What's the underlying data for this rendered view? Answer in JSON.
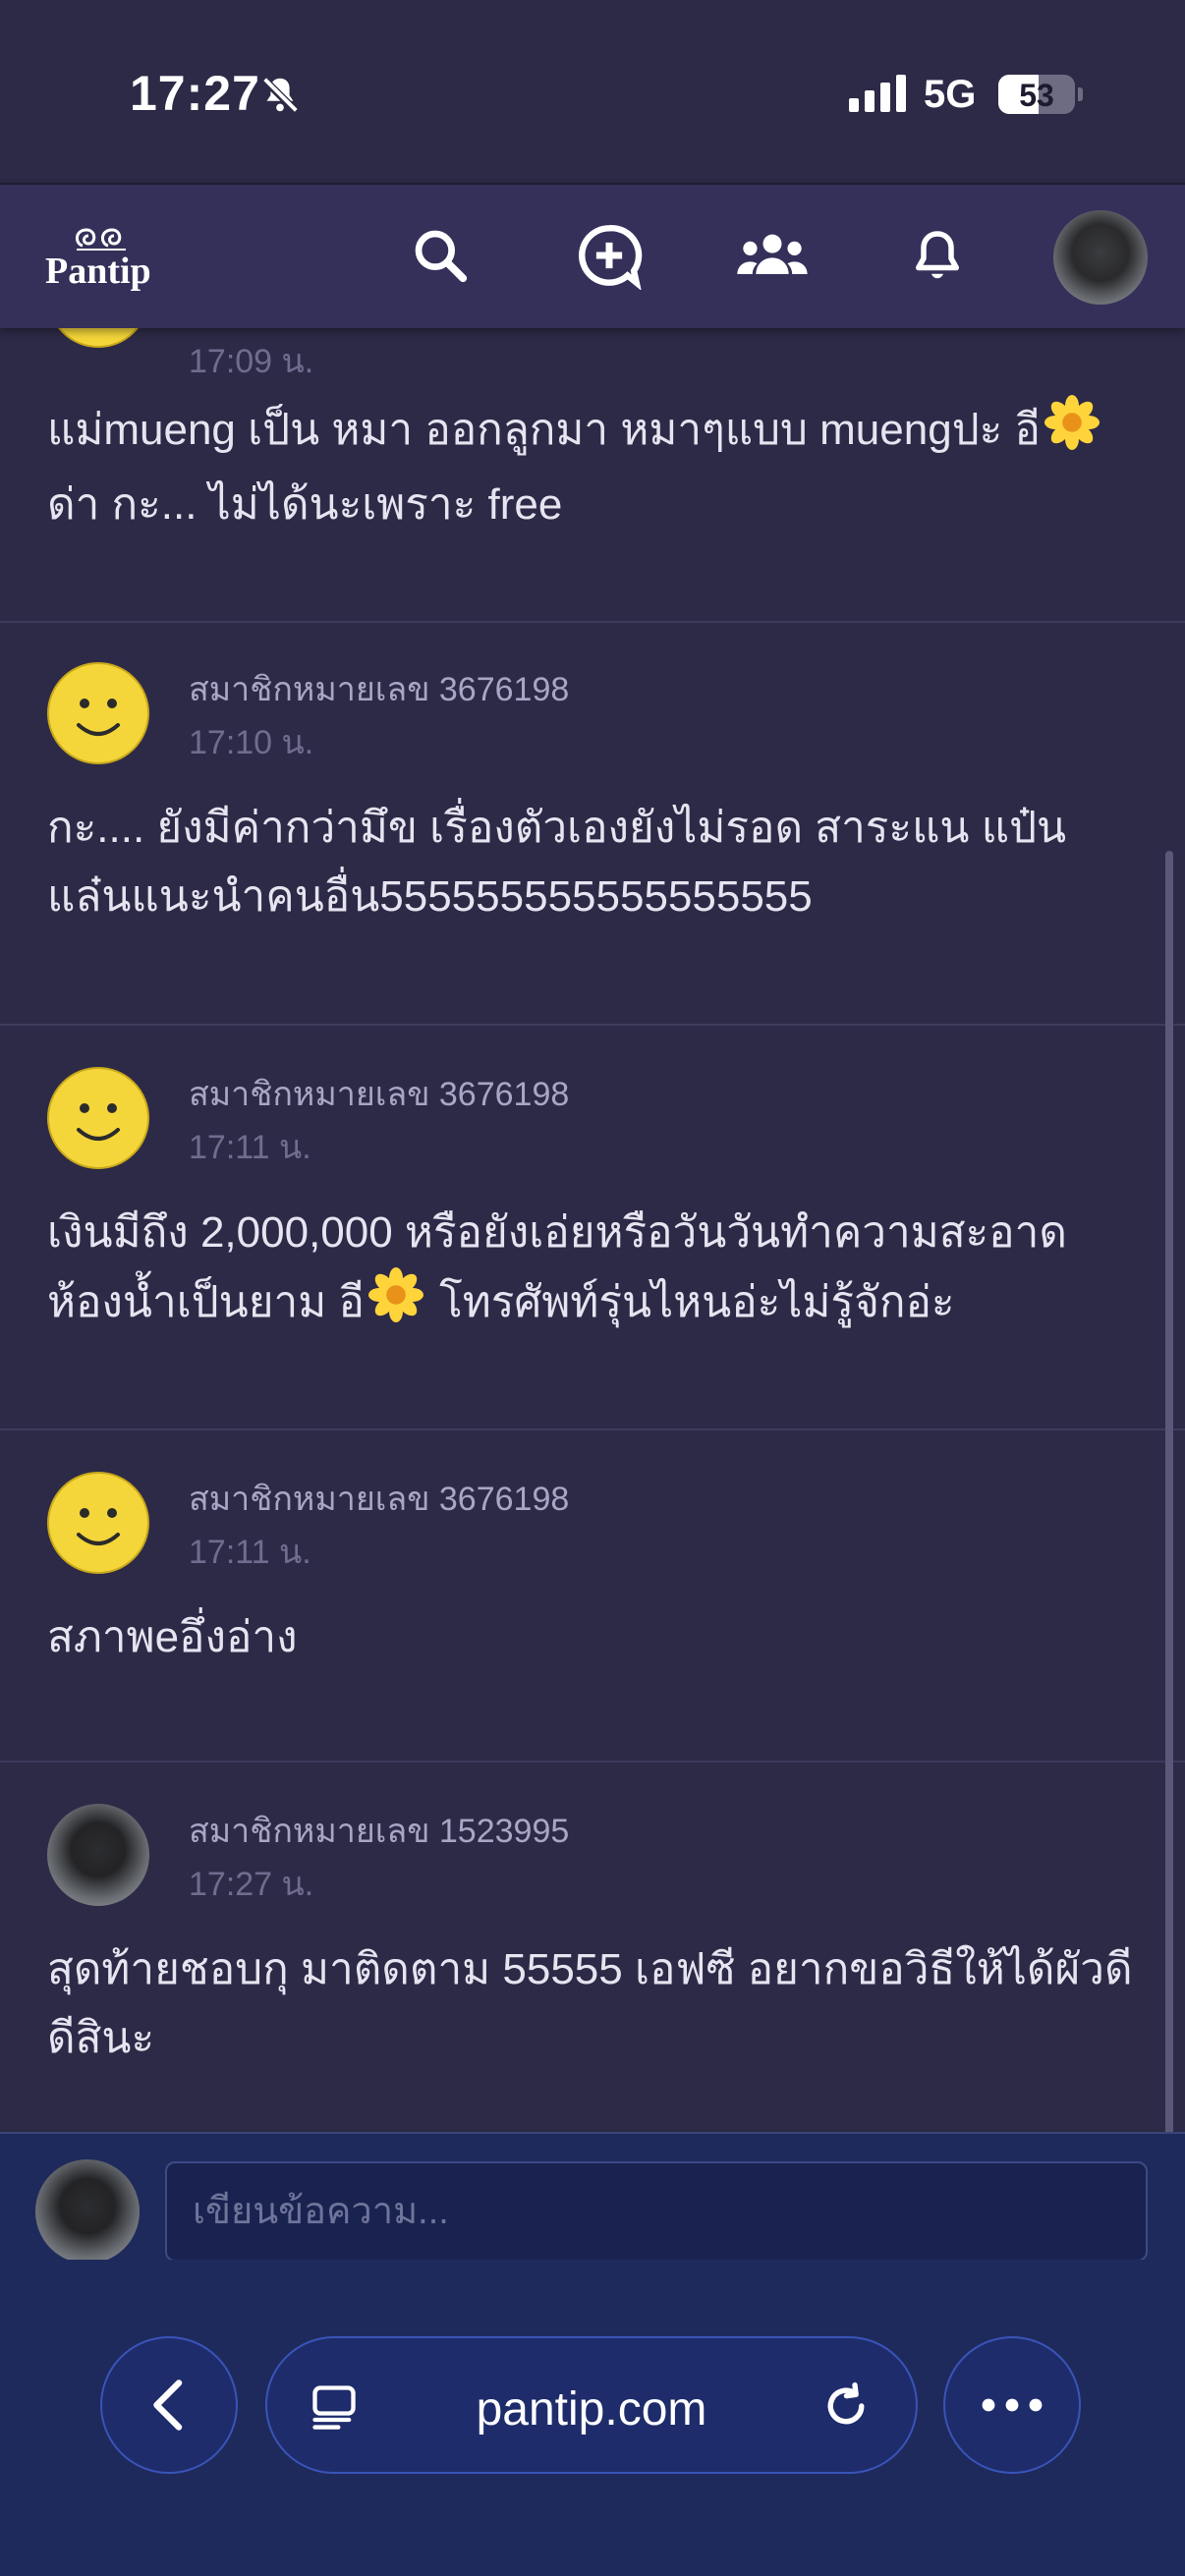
{
  "status_bar": {
    "time": "17:27",
    "network": "5G",
    "battery": "53"
  },
  "header": {
    "logo_text": "Pantip"
  },
  "comments": [
    {
      "username": "",
      "time": "17:09 น.",
      "text_before": "แม่mueng เป็น หมา ออกลูกมา หมาๆแบบ muengปะ อี",
      "text_after": " ด่า กะ... ไม่ได้นะเพราะ free",
      "avatar": "smiley"
    },
    {
      "username": "สมาชิกหมายเลข 3676198",
      "time": "17:10 น.",
      "text": "กะ.... ยังมีค่ากว่ามึข เรื่องตัวเองยังไม่รอด สาระแน แป๋นแล๋นแนะนำคนอื่น555555555555555555",
      "avatar": "smiley"
    },
    {
      "username": "สมาชิกหมายเลข 3676198",
      "time": "17:11 น.",
      "text_before": "เงินมีถึง 2,000,000 หรือยังเอ่ยหรือวันวันทำความสะอาดห้องน้ำเป็นยาม  อี",
      "text_after": " โทรศัพท์รุ่นไหนอ่ะไม่รู้จักอ่ะ",
      "avatar": "smiley"
    },
    {
      "username": "สมาชิกหมายเลข 3676198",
      "time": "17:11 น.",
      "text": "สภาพeอึ่งอ่าง",
      "avatar": "smiley"
    },
    {
      "username": "สมาชิกหมายเลข 1523995",
      "time": "17:27 น.",
      "text": "สุดท้ายชอบกุ มาติดตาม 55555 เอฟซี อยากขอวิธีให้ได้ผัวดีดีสินะ",
      "avatar": "photo"
    }
  ],
  "reply": {
    "placeholder": "เขียนข้อความ..."
  },
  "browser": {
    "url": "pantip.com"
  }
}
